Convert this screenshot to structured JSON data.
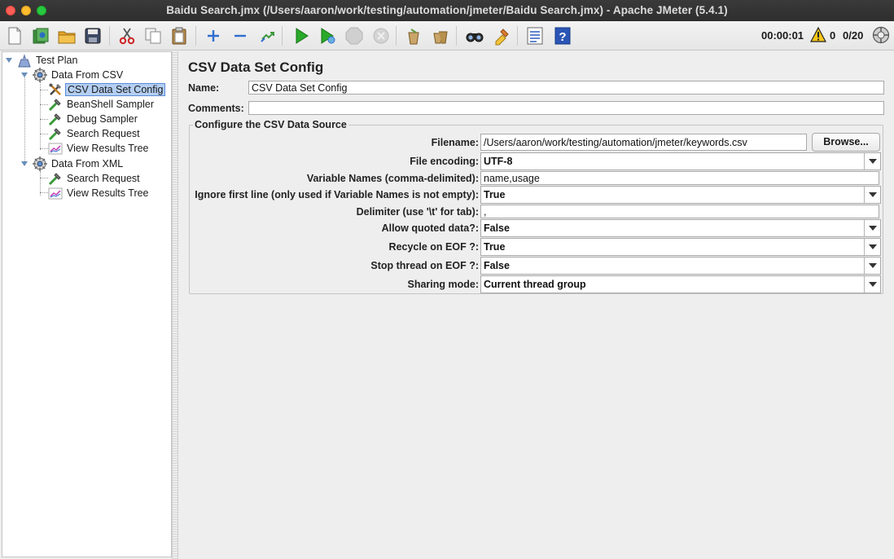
{
  "window": {
    "title": "Baidu Search.jmx (/Users/aaron/work/testing/automation/jmeter/Baidu Search.jmx) - Apache JMeter (5.4.1)"
  },
  "toolbar": {
    "buttons": [
      {
        "name": "new-icon"
      },
      {
        "name": "templates-icon"
      },
      {
        "name": "open-icon"
      },
      {
        "name": "save-icon"
      },
      {
        "name": "cut-icon"
      },
      {
        "name": "copy-icon"
      },
      {
        "name": "paste-icon"
      },
      {
        "name": "expand-icon"
      },
      {
        "name": "collapse-icon"
      },
      {
        "name": "toggle-icon"
      },
      {
        "name": "start-icon"
      },
      {
        "name": "start-no-pauses-icon"
      },
      {
        "name": "stop-icon"
      },
      {
        "name": "shutdown-icon"
      },
      {
        "name": "clear-icon"
      },
      {
        "name": "clear-all-icon"
      },
      {
        "name": "search-icon"
      },
      {
        "name": "reset-search-icon"
      },
      {
        "name": "function-helper-icon"
      },
      {
        "name": "help-icon"
      }
    ],
    "elapsed_time": "00:00:01",
    "warning_count": "0",
    "thread_count": "0/20"
  },
  "tree": {
    "items": [
      {
        "label": "Test Plan",
        "icon": "test-plan-icon"
      },
      {
        "label": "Data From CSV",
        "icon": "thread-group-icon"
      },
      {
        "label": "CSV Data Set Config",
        "icon": "config-element-icon",
        "selected": true
      },
      {
        "label": "BeanShell Sampler",
        "icon": "sampler-icon"
      },
      {
        "label": "Debug Sampler",
        "icon": "sampler-icon"
      },
      {
        "label": "Search Request",
        "icon": "sampler-icon"
      },
      {
        "label": "View Results Tree",
        "icon": "listener-icon"
      },
      {
        "label": "Data From XML",
        "icon": "thread-group-icon"
      },
      {
        "label": "Search Request",
        "icon": "sampler-icon"
      },
      {
        "label": "View Results Tree",
        "icon": "listener-icon"
      }
    ]
  },
  "config": {
    "panel_title": "CSV Data Set Config",
    "name_label": "Name:",
    "name_value": "CSV Data Set Config",
    "comments_label": "Comments:",
    "comments_value": "",
    "group_title": "Configure the CSV Data Source",
    "filename_label": "Filename:",
    "filename_value": "/Users/aaron/work/testing/automation/jmeter/keywords.csv",
    "browse_label": "Browse...",
    "file_encoding_label": "File encoding:",
    "file_encoding_value": "UTF-8",
    "variable_names_label": "Variable Names (comma-delimited):",
    "variable_names_value": "name,usage",
    "ignore_first_line_label": "Ignore first line (only used if Variable Names is not empty):",
    "ignore_first_line_value": "True",
    "delimiter_label": "Delimiter (use '\\t' for tab):",
    "delimiter_value": ",",
    "allow_quoted_label": "Allow quoted data?:",
    "allow_quoted_value": "False",
    "recycle_eof_label": "Recycle on EOF ?:",
    "recycle_eof_value": "True",
    "stop_thread_label": "Stop thread on EOF ?:",
    "stop_thread_value": "False",
    "sharing_mode_label": "Sharing mode:",
    "sharing_mode_value": "Current thread group"
  }
}
